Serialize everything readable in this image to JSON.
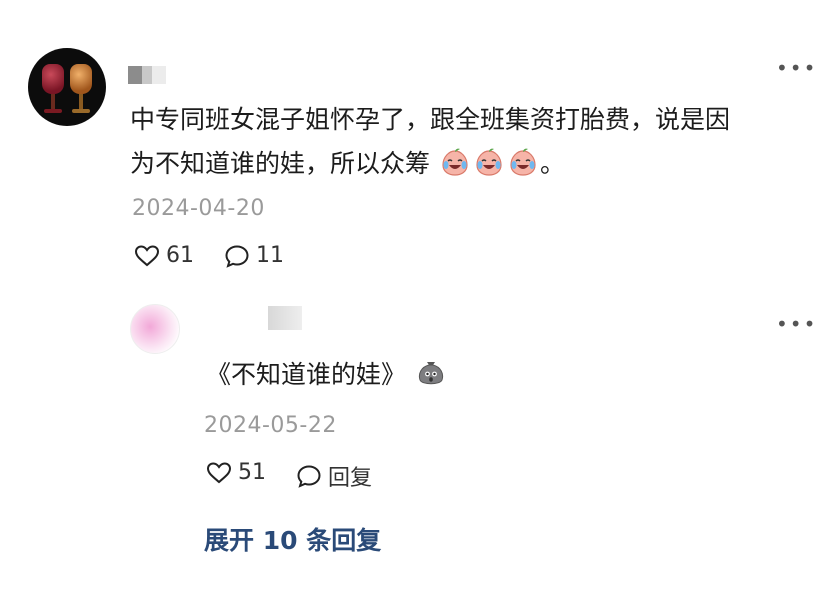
{
  "main_comment": {
    "content": "中专同班女混子姐怀孕了，跟全班集资打胎费，说是因为不知道道谁的娃，所以众筹",
    "content_part1": "中专同班女混子姐怀孕了，跟全班集资打胎费，说是因",
    "content_part2": "为不知道谁的娃，所以众筹",
    "content_end": "。",
    "emoji_icon": "crying-laughing-peach-emoji",
    "emoji_count": 3,
    "date": "2024-04-20",
    "likes": "61",
    "comments": "11"
  },
  "reply": {
    "content": "《不知道谁的娃》",
    "emoji_icon": "shocked-bag-emoji",
    "date": "2024-05-22",
    "likes": "51",
    "reply_label": "回复"
  },
  "expand_label": "展开 10 条回复",
  "colors": {
    "accent": "#2a4a78",
    "date": "#9a9a9a"
  }
}
